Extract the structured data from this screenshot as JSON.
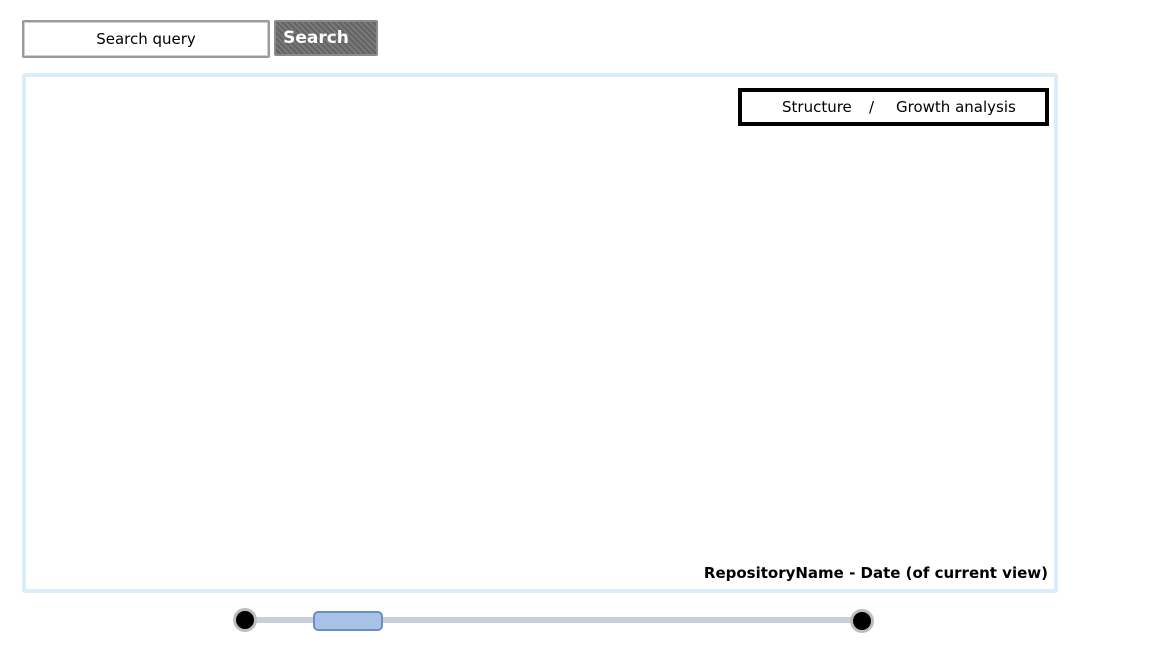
{
  "search": {
    "placeholder": "Search query",
    "button_label": "Search"
  },
  "view_toggle": {
    "structure_label": "Structure",
    "separator": "/",
    "growth_label": "Growth analysis"
  },
  "canvas": {
    "repository_label": "RepositoryName - Date (of current view)"
  },
  "timeline": {
    "position_fraction": 0.12
  },
  "colors": {
    "canvas_border": "#d9eef8",
    "timeline_handle": "#a9c3e6",
    "search_button": "#6e6e6e"
  }
}
